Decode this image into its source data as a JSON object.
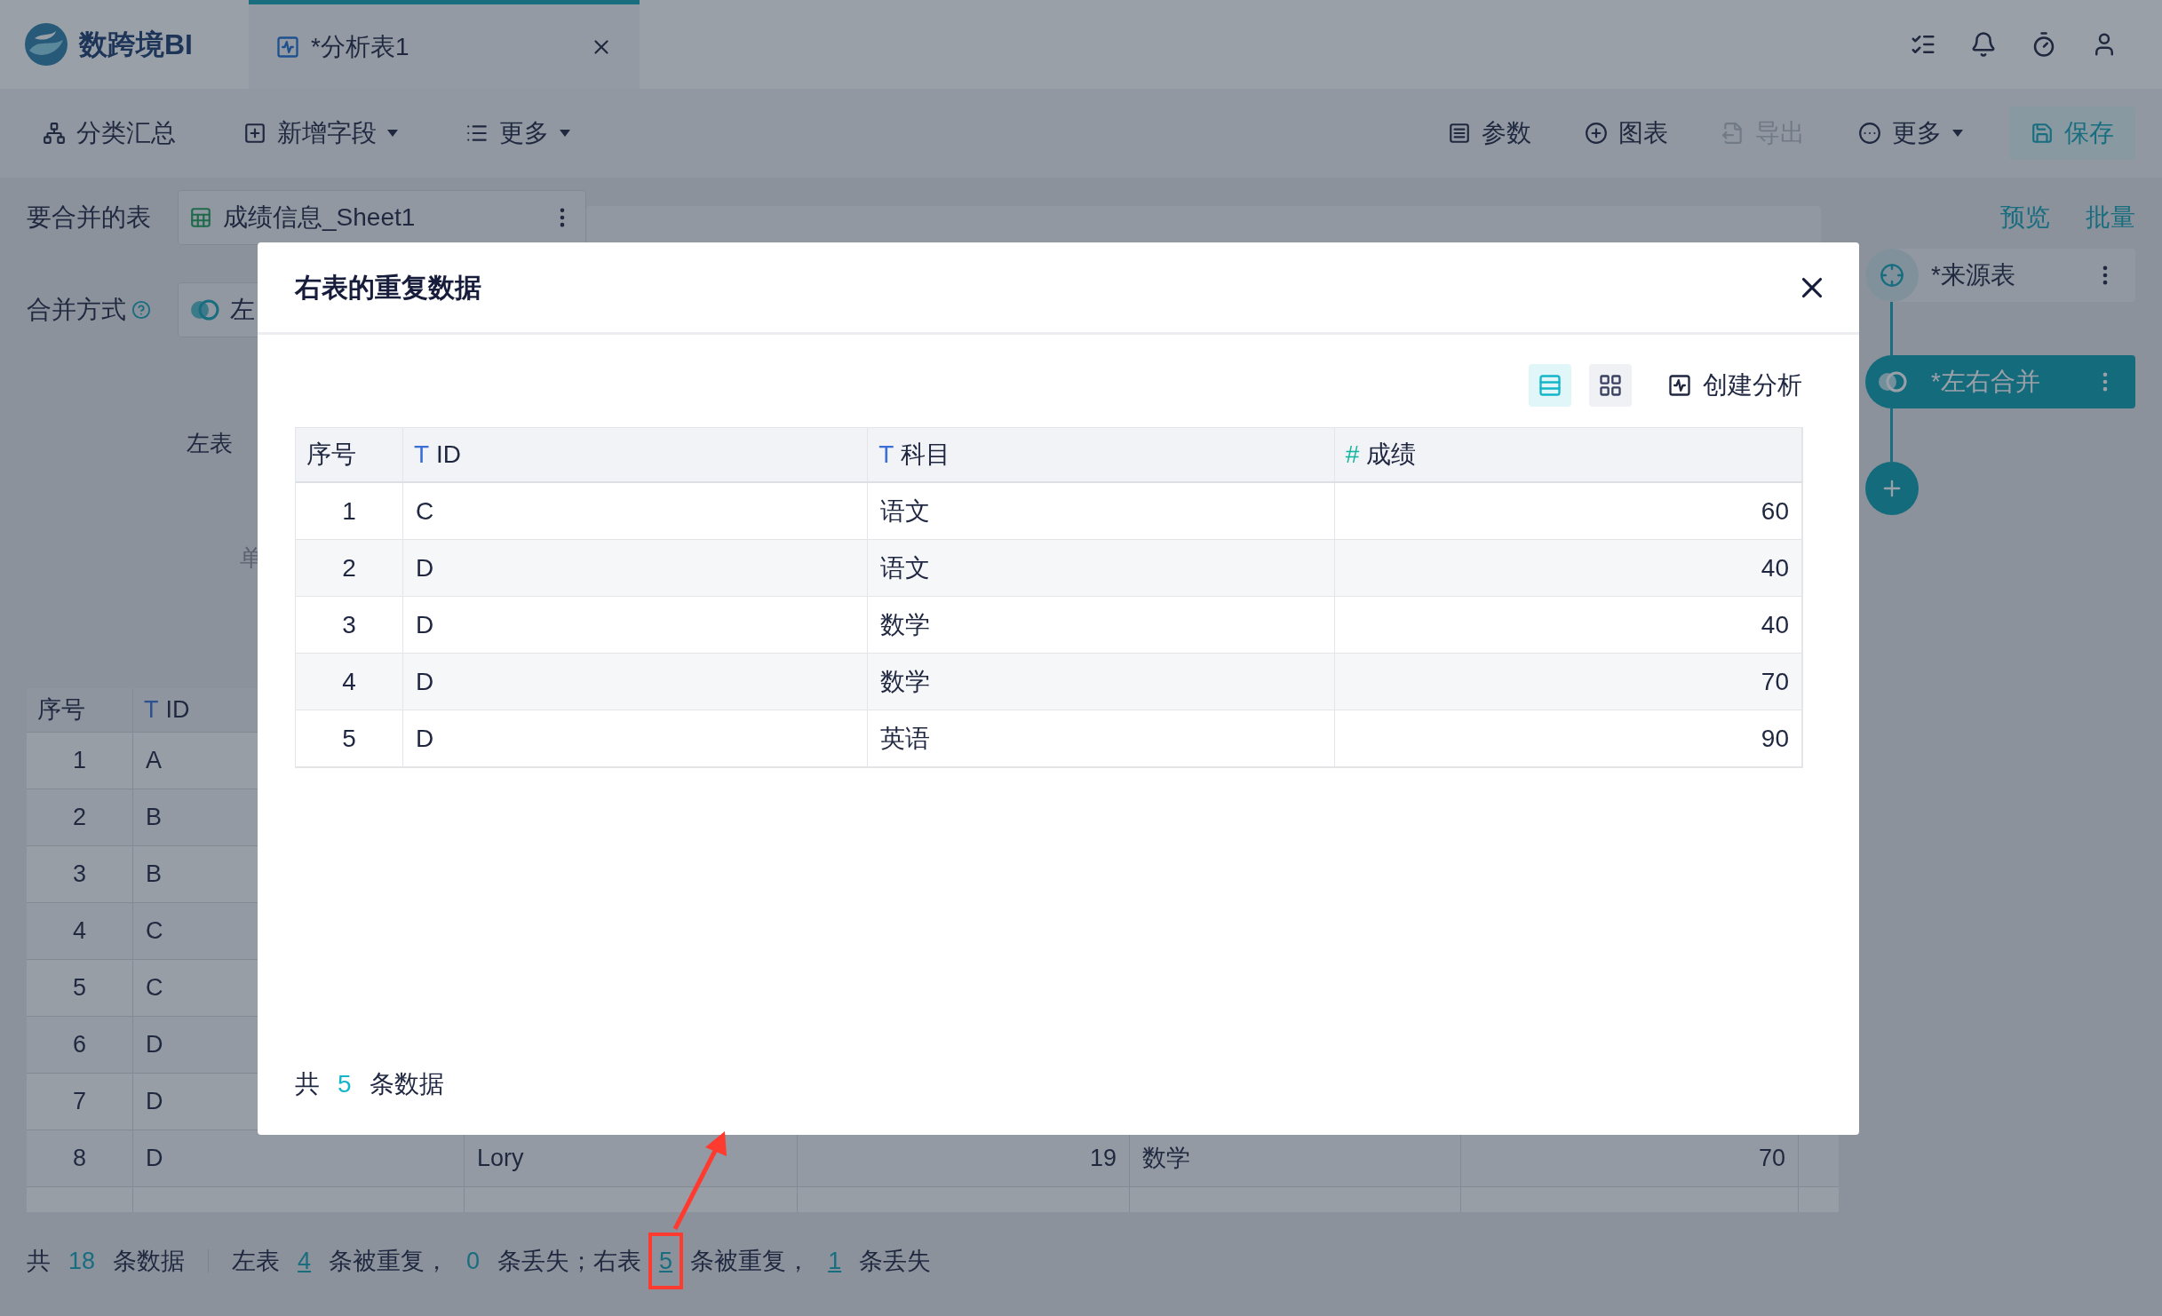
{
  "app": {
    "logo": "数跨境BI"
  },
  "tabs": [
    {
      "label": "*分析表1",
      "selected": true
    }
  ],
  "toolbar": {
    "left": [
      {
        "label": "分类汇总",
        "dropdown": false,
        "disabled": false
      },
      {
        "label": "新增字段",
        "dropdown": true,
        "disabled": false
      },
      {
        "label": "更多",
        "dropdown": true,
        "disabled": false
      }
    ],
    "right": [
      {
        "label": "参数",
        "dropdown": false,
        "disabled": false
      },
      {
        "label": "图表",
        "dropdown": false,
        "disabled": false
      },
      {
        "label": "导出",
        "dropdown": false,
        "disabled": true
      },
      {
        "label": "更多",
        "dropdown": true,
        "disabled": false
      }
    ],
    "save": "保存"
  },
  "merge_panel": {
    "table_label": "要合并的表",
    "table_value": "成绩信息_Sheet1",
    "method_label": "合并方式",
    "method_value": "左",
    "left_label": "左表",
    "unit_label": "单"
  },
  "sidebar": {
    "links": [
      "预览",
      "批量"
    ],
    "nodes": [
      {
        "label": "*来源表",
        "kind": "source",
        "selected": false
      },
      {
        "label": "*左右合并",
        "kind": "merge",
        "selected": true
      }
    ]
  },
  "bg_table": {
    "columns": [
      {
        "label": "序号",
        "kind": "index"
      },
      {
        "label": "ID",
        "kind": "text",
        "type_mark": "T"
      }
    ],
    "rows": [
      [
        "1",
        "A"
      ],
      [
        "2",
        "B"
      ],
      [
        "3",
        "B"
      ],
      [
        "4",
        "C"
      ],
      [
        "5",
        "C"
      ],
      [
        "6",
        "D"
      ],
      [
        "7",
        "D"
      ],
      [
        "8",
        "D",
        "Lory",
        "19",
        "数学",
        "70"
      ]
    ]
  },
  "footer": {
    "segments": [
      {
        "kind": "text",
        "text": "共"
      },
      {
        "kind": "count",
        "text": "18",
        "link": false
      },
      {
        "kind": "text",
        "text": "条数据"
      },
      {
        "kind": "divider"
      },
      {
        "kind": "text",
        "text": "左表"
      },
      {
        "kind": "count",
        "text": "4",
        "link": true
      },
      {
        "kind": "text",
        "text": "条被重复，"
      },
      {
        "kind": "count",
        "text": "0",
        "link": false
      },
      {
        "kind": "text",
        "text": "条丢失；右表"
      },
      {
        "kind": "count",
        "text": "5",
        "link": true,
        "highlighted": true
      },
      {
        "kind": "text",
        "text": "条被重复，"
      },
      {
        "kind": "count",
        "text": "1",
        "link": true
      },
      {
        "kind": "text",
        "text": "条丢失"
      }
    ]
  },
  "dialog": {
    "title": "右表的重复数据",
    "view_buttons": [
      {
        "kind": "rows",
        "selected": true
      },
      {
        "kind": "grid",
        "selected": false
      }
    ],
    "create_analysis": "创建分析",
    "table": {
      "columns": [
        {
          "label": "序号",
          "kind": "index"
        },
        {
          "label": "ID",
          "kind": "text",
          "type_mark": "T"
        },
        {
          "label": "科目",
          "kind": "text",
          "type_mark": "T"
        },
        {
          "label": "成绩",
          "kind": "number",
          "type_mark": "#"
        }
      ],
      "rows": [
        [
          "1",
          "C",
          "语文",
          "60"
        ],
        [
          "2",
          "D",
          "语文",
          "40"
        ],
        [
          "3",
          "D",
          "数学",
          "40"
        ],
        [
          "4",
          "D",
          "数学",
          "70"
        ],
        [
          "5",
          "D",
          "英语",
          "90"
        ]
      ]
    },
    "footer": {
      "prefix": "共",
      "count": "5",
      "suffix": "条数据"
    }
  }
}
